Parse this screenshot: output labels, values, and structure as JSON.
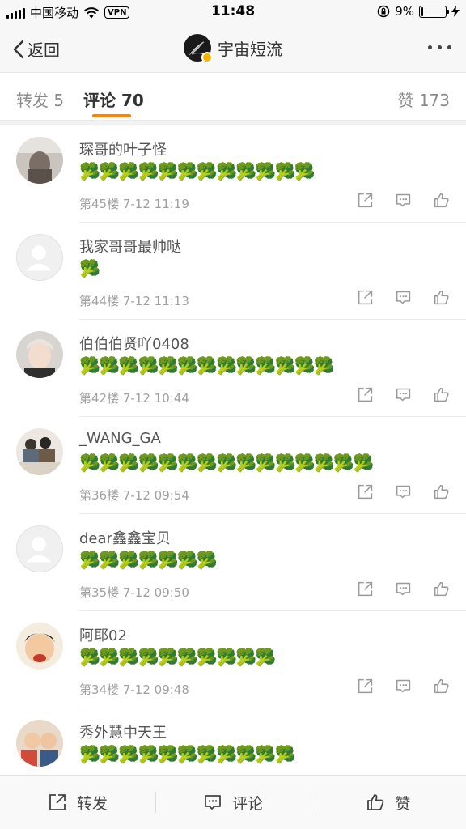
{
  "status_bar": {
    "carrier": "中国移动",
    "vpn": "VPN",
    "time": "11:48",
    "battery": "9%",
    "battery_level": 0.09
  },
  "navbar": {
    "back_label": "返回",
    "title": "宇宙短流"
  },
  "tabs": {
    "forward": "转发 5",
    "comments": "评论 70",
    "likes": "赞 173",
    "accent_color": "#ff8200"
  },
  "comments": [
    {
      "username": "琛哥的叶子怪",
      "content": "🥦🥦🥦🥦🥦🥦🥦🥦🥦🥦🥦🥦",
      "meta": "第45楼 7-12 11:19",
      "avatar": "photo"
    },
    {
      "username": "我家哥哥最帅哒",
      "content": "🥦",
      "meta": "第44楼 7-12 11:13",
      "avatar": "default"
    },
    {
      "username": "伯伯伯贤吖0408",
      "content": "🥦🥦🥦🥦🥦🥦🥦🥦🥦🥦🥦🥦🥦",
      "meta": "第42楼 7-12 10:44",
      "avatar": "photo"
    },
    {
      "username": "_WANG_GA",
      "content": "🥦🥦🥦🥦🥦🥦🥦🥦🥦🥦🥦🥦🥦🥦🥦",
      "meta": "第36楼 7-12 09:54",
      "avatar": "photo"
    },
    {
      "username": "dear鑫鑫宝贝",
      "content": "🥦🥦🥦🥦🥦🥦🥦",
      "meta": "第35楼 7-12 09:50",
      "avatar": "default"
    },
    {
      "username": "阿耶02",
      "content": "🥦🥦🥦🥦🥦🥦🥦🥦🥦🥦",
      "meta": "第34楼 7-12 09:48",
      "avatar": "photo"
    },
    {
      "username": "秀外慧中天王",
      "content": "🥦🥦🥦🥦🥦🥦🥦🥦🥦🥦🥦",
      "meta": "",
      "avatar": "photo"
    }
  ],
  "bottom_bar": {
    "forward": "转发",
    "comment": "评论",
    "like": "赞"
  }
}
